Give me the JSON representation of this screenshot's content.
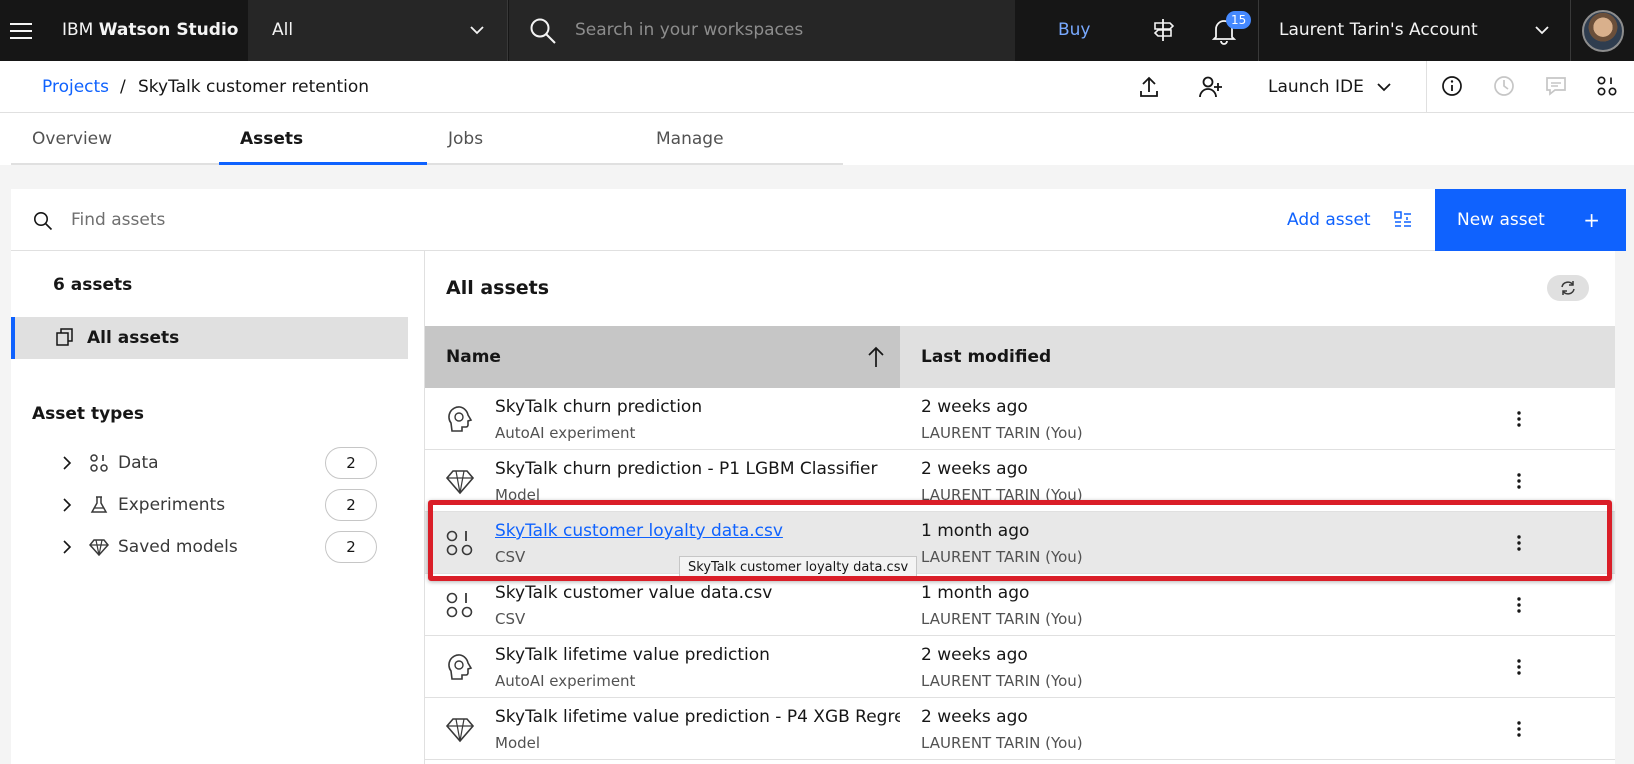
{
  "topbar": {
    "brand_prefix": "IBM",
    "brand_name": "Watson Studio",
    "scope_value": "All",
    "search_placeholder": "Search in your workspaces",
    "buy_label": "Buy",
    "notification_count": "15",
    "account_name": "Laurent Tarin's Account"
  },
  "breadcrumb": {
    "parent": "Projects",
    "separator": "/",
    "current": "SkyTalk customer retention"
  },
  "header_actions": {
    "launch_ide": "Launch IDE"
  },
  "tabs": [
    {
      "label": "Overview",
      "active": false
    },
    {
      "label": "Assets",
      "active": true
    },
    {
      "label": "Jobs",
      "active": false
    },
    {
      "label": "Manage",
      "active": false
    }
  ],
  "toolbar": {
    "find_placeholder": "Find assets",
    "add_asset": "Add asset",
    "new_asset": "New asset",
    "new_asset_plus": "+"
  },
  "sidebar": {
    "count": "6 assets",
    "all_assets": "All assets",
    "asset_types_heading": "Asset types",
    "types": [
      {
        "label": "Data",
        "count": "2",
        "icon": "data-icon"
      },
      {
        "label": "Experiments",
        "count": "2",
        "icon": "flask-icon"
      },
      {
        "label": "Saved models",
        "count": "2",
        "icon": "diamond-icon"
      }
    ]
  },
  "list": {
    "title": "All assets",
    "columns": {
      "name": "Name",
      "modified": "Last modified"
    },
    "rows": [
      {
        "name": "SkyTalk churn prediction",
        "type": "AutoAI experiment",
        "when": "2 weeks ago",
        "who": "LAURENT TARIN (You)",
        "icon": "autoai-icon"
      },
      {
        "name": "SkyTalk churn prediction - P1 LGBM Classifier",
        "type": "Model",
        "when": "2 weeks ago",
        "who": "LAURENT TARIN (You)",
        "icon": "model-icon"
      },
      {
        "name": "SkyTalk customer loyalty data.csv",
        "type": "CSV",
        "when": "1 month ago",
        "who": "LAURENT TARIN (You)",
        "icon": "data-icon"
      },
      {
        "name": "SkyTalk customer value data.csv",
        "type": "CSV",
        "when": "1 month ago",
        "who": "LAURENT TARIN (You)",
        "icon": "data-icon"
      },
      {
        "name": "SkyTalk lifetime value prediction",
        "type": "AutoAI experiment",
        "when": "2 weeks ago",
        "who": "LAURENT TARIN (You)",
        "icon": "autoai-icon"
      },
      {
        "name": "SkyTalk lifetime value prediction - P4 XGB Regre",
        "type": "Model",
        "when": "2 weeks ago",
        "who": "LAURENT TARIN (You)",
        "icon": "model-icon"
      }
    ],
    "tooltip": "SkyTalk customer loyalty data.csv"
  },
  "colors": {
    "accent": "#0f62fe",
    "topbar_bg": "#161616",
    "highlight": "#da1e28"
  }
}
